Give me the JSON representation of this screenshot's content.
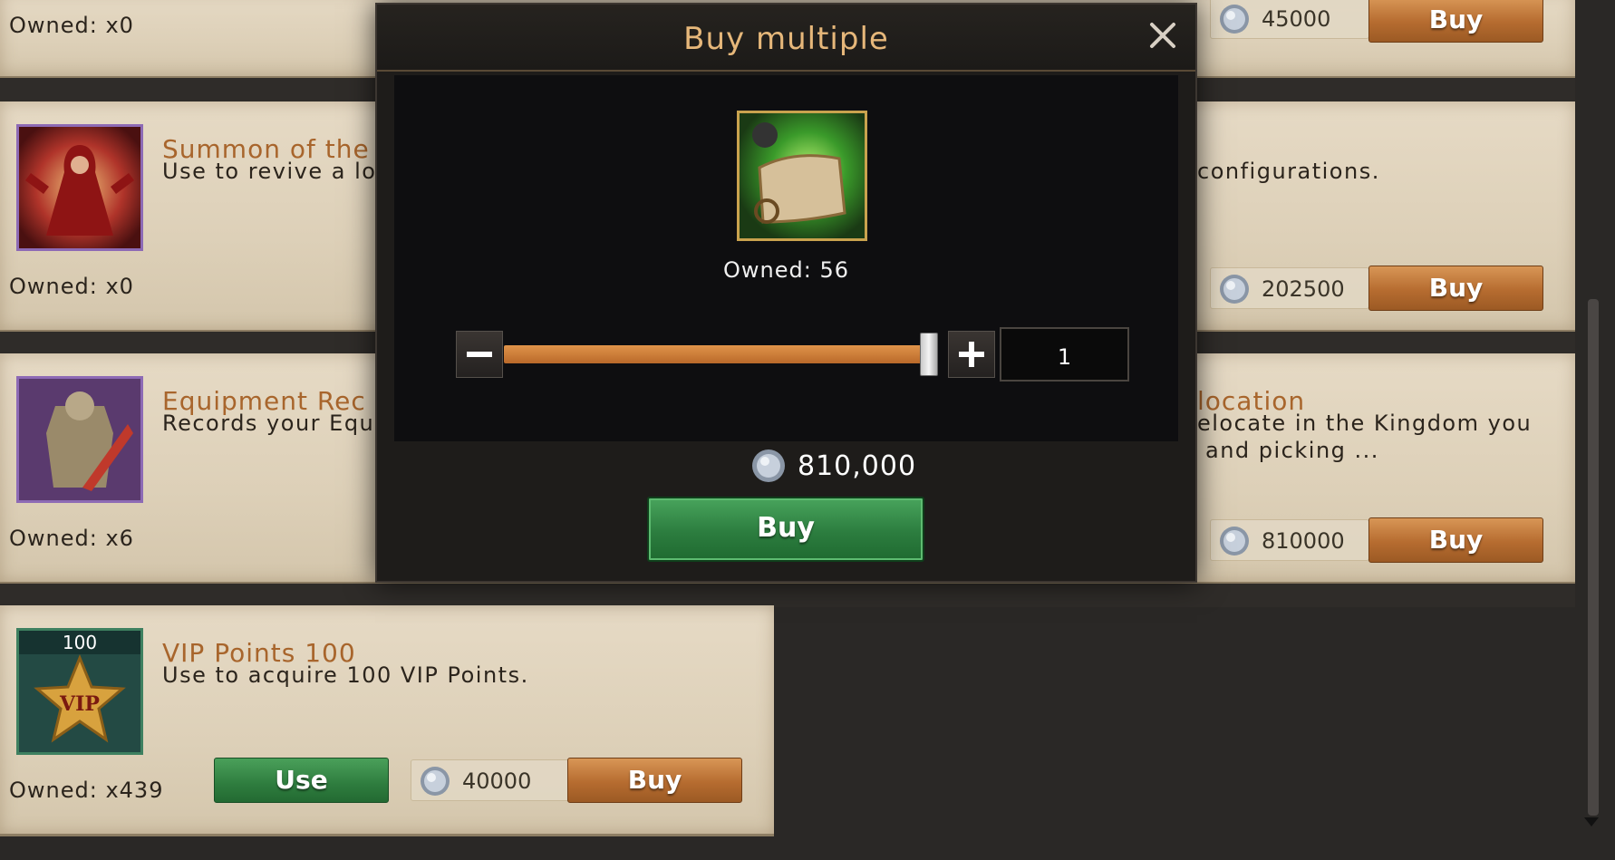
{
  "cards": [
    {
      "title": "",
      "description": "",
      "owned": "Owned: x0",
      "price": "45000",
      "buy_label": "Buy"
    },
    {
      "title": "Summon of the",
      "description": "Use to revive a lo",
      "description_right": "configurations.",
      "owned": "Owned: x0",
      "price": "202500",
      "buy_label": "Buy"
    },
    {
      "title": "Equipment Rec",
      "title_right": "location",
      "description": "Records your Equ",
      "description_right_1": "elocate in the Kingdom you",
      "description_right_2": "and picking ...",
      "owned": "Owned: x6",
      "price": "810000",
      "buy_label": "Buy"
    },
    {
      "title": "VIP Points 100",
      "description": "Use to acquire 100 VIP Points.",
      "owned": "Owned: x439",
      "badge": "100",
      "vip_text": "VIP",
      "use_label": "Use",
      "price": "40000",
      "buy_label": "Buy"
    }
  ],
  "modal": {
    "title": "Buy multiple",
    "owned": "Owned: 56",
    "quantity": "1",
    "slider_fraction": 1.0,
    "total": "810,000",
    "buy_label": "Buy"
  },
  "icons": {
    "currency": "silver-coin-icon",
    "close": "close-icon",
    "minus": "minus-icon",
    "plus": "plus-icon"
  },
  "colors": {
    "accent_title": "#a8652c",
    "buy_button": "#b66c30",
    "use_button": "#2e7c3e",
    "modal_title": "#e6b77a"
  }
}
